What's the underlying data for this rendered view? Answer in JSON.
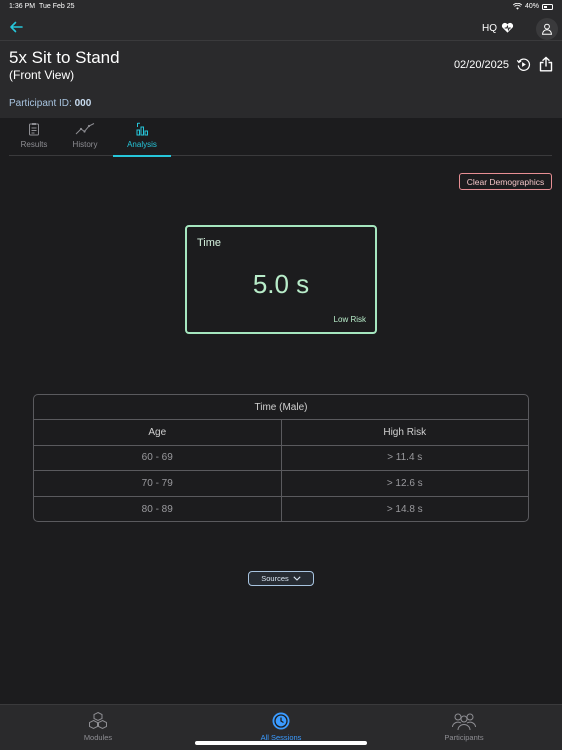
{
  "status_bar": {
    "time": "1:36 PM",
    "date": "Tue Feb 25",
    "battery": "40%"
  },
  "header": {
    "org": "HQ",
    "title": "5x Sit to Stand",
    "subtitle": "(Front View)",
    "date": "02/20/2025",
    "participant_label": "Participant ID:",
    "participant_id": "000"
  },
  "tabs": [
    {
      "label": "Results",
      "icon": "clipboard-icon"
    },
    {
      "label": "History",
      "icon": "trend-line-icon"
    },
    {
      "label": "Analysis",
      "icon": "bar-analysis-icon",
      "active": true
    }
  ],
  "actions": {
    "clear_demographics": "Clear Demographics",
    "sources": "Sources"
  },
  "result": {
    "label": "Time",
    "value": "5.0 s",
    "risk": "Low Risk"
  },
  "norms_table": {
    "caption": "Time (Male)",
    "columns": [
      "Age",
      "High Risk"
    ],
    "rows": [
      [
        "60 - 69",
        "> 11.4 s"
      ],
      [
        "70 - 79",
        "> 12.6 s"
      ],
      [
        "80 - 89",
        "> 14.8 s"
      ]
    ]
  },
  "bottom_nav": [
    {
      "label": "Modules",
      "icon": "modules-icon"
    },
    {
      "label": "All Sessions",
      "icon": "sessions-clock-icon",
      "active": true
    },
    {
      "label": "Participants",
      "icon": "participants-icon"
    }
  ],
  "colors": {
    "accent_tab": "#26c6da",
    "accent_nav": "#3b9bff",
    "result_green": "#a5e6bf",
    "clear_red": "#e88f94"
  }
}
